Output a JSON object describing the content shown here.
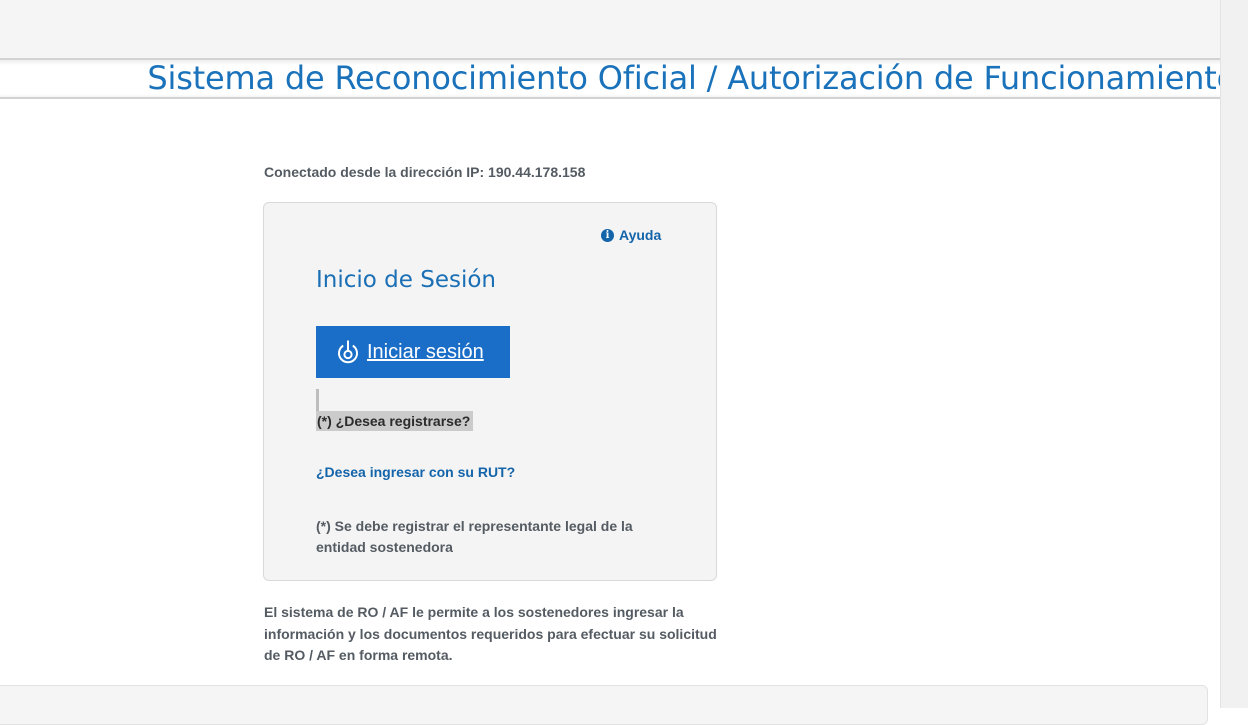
{
  "header": {
    "title": "Sistema de Reconocimiento Oficial / Autorización de Funcionamiento"
  },
  "connection": {
    "ip_text": "Conectado desde la dirección IP: 190.44.178.158"
  },
  "login_card": {
    "help_icon": "info-circle-icon",
    "help_label": "Ayuda",
    "title": "Inicio de Sesión",
    "login_button_icon": "power-icon",
    "login_button_label": "Iniciar sesión",
    "register_link": "(*) ¿Desea registrarse?",
    "rut_link": "¿Desea ingresar con su RUT?",
    "footnote": "(*) Se debe registrar el representante legal de la entidad sostenedora"
  },
  "description": "El sistema de RO / AF le permite a los sostenedores ingresar la información y los documentos requeridos para efectuar su solicitud de RO / AF en forma remota.",
  "colors": {
    "brand_blue": "#1a72bb",
    "button_blue": "#1a6ec7",
    "link_blue": "#1464aa",
    "text_gray": "#545b62",
    "card_background": "#f4f4f4"
  }
}
